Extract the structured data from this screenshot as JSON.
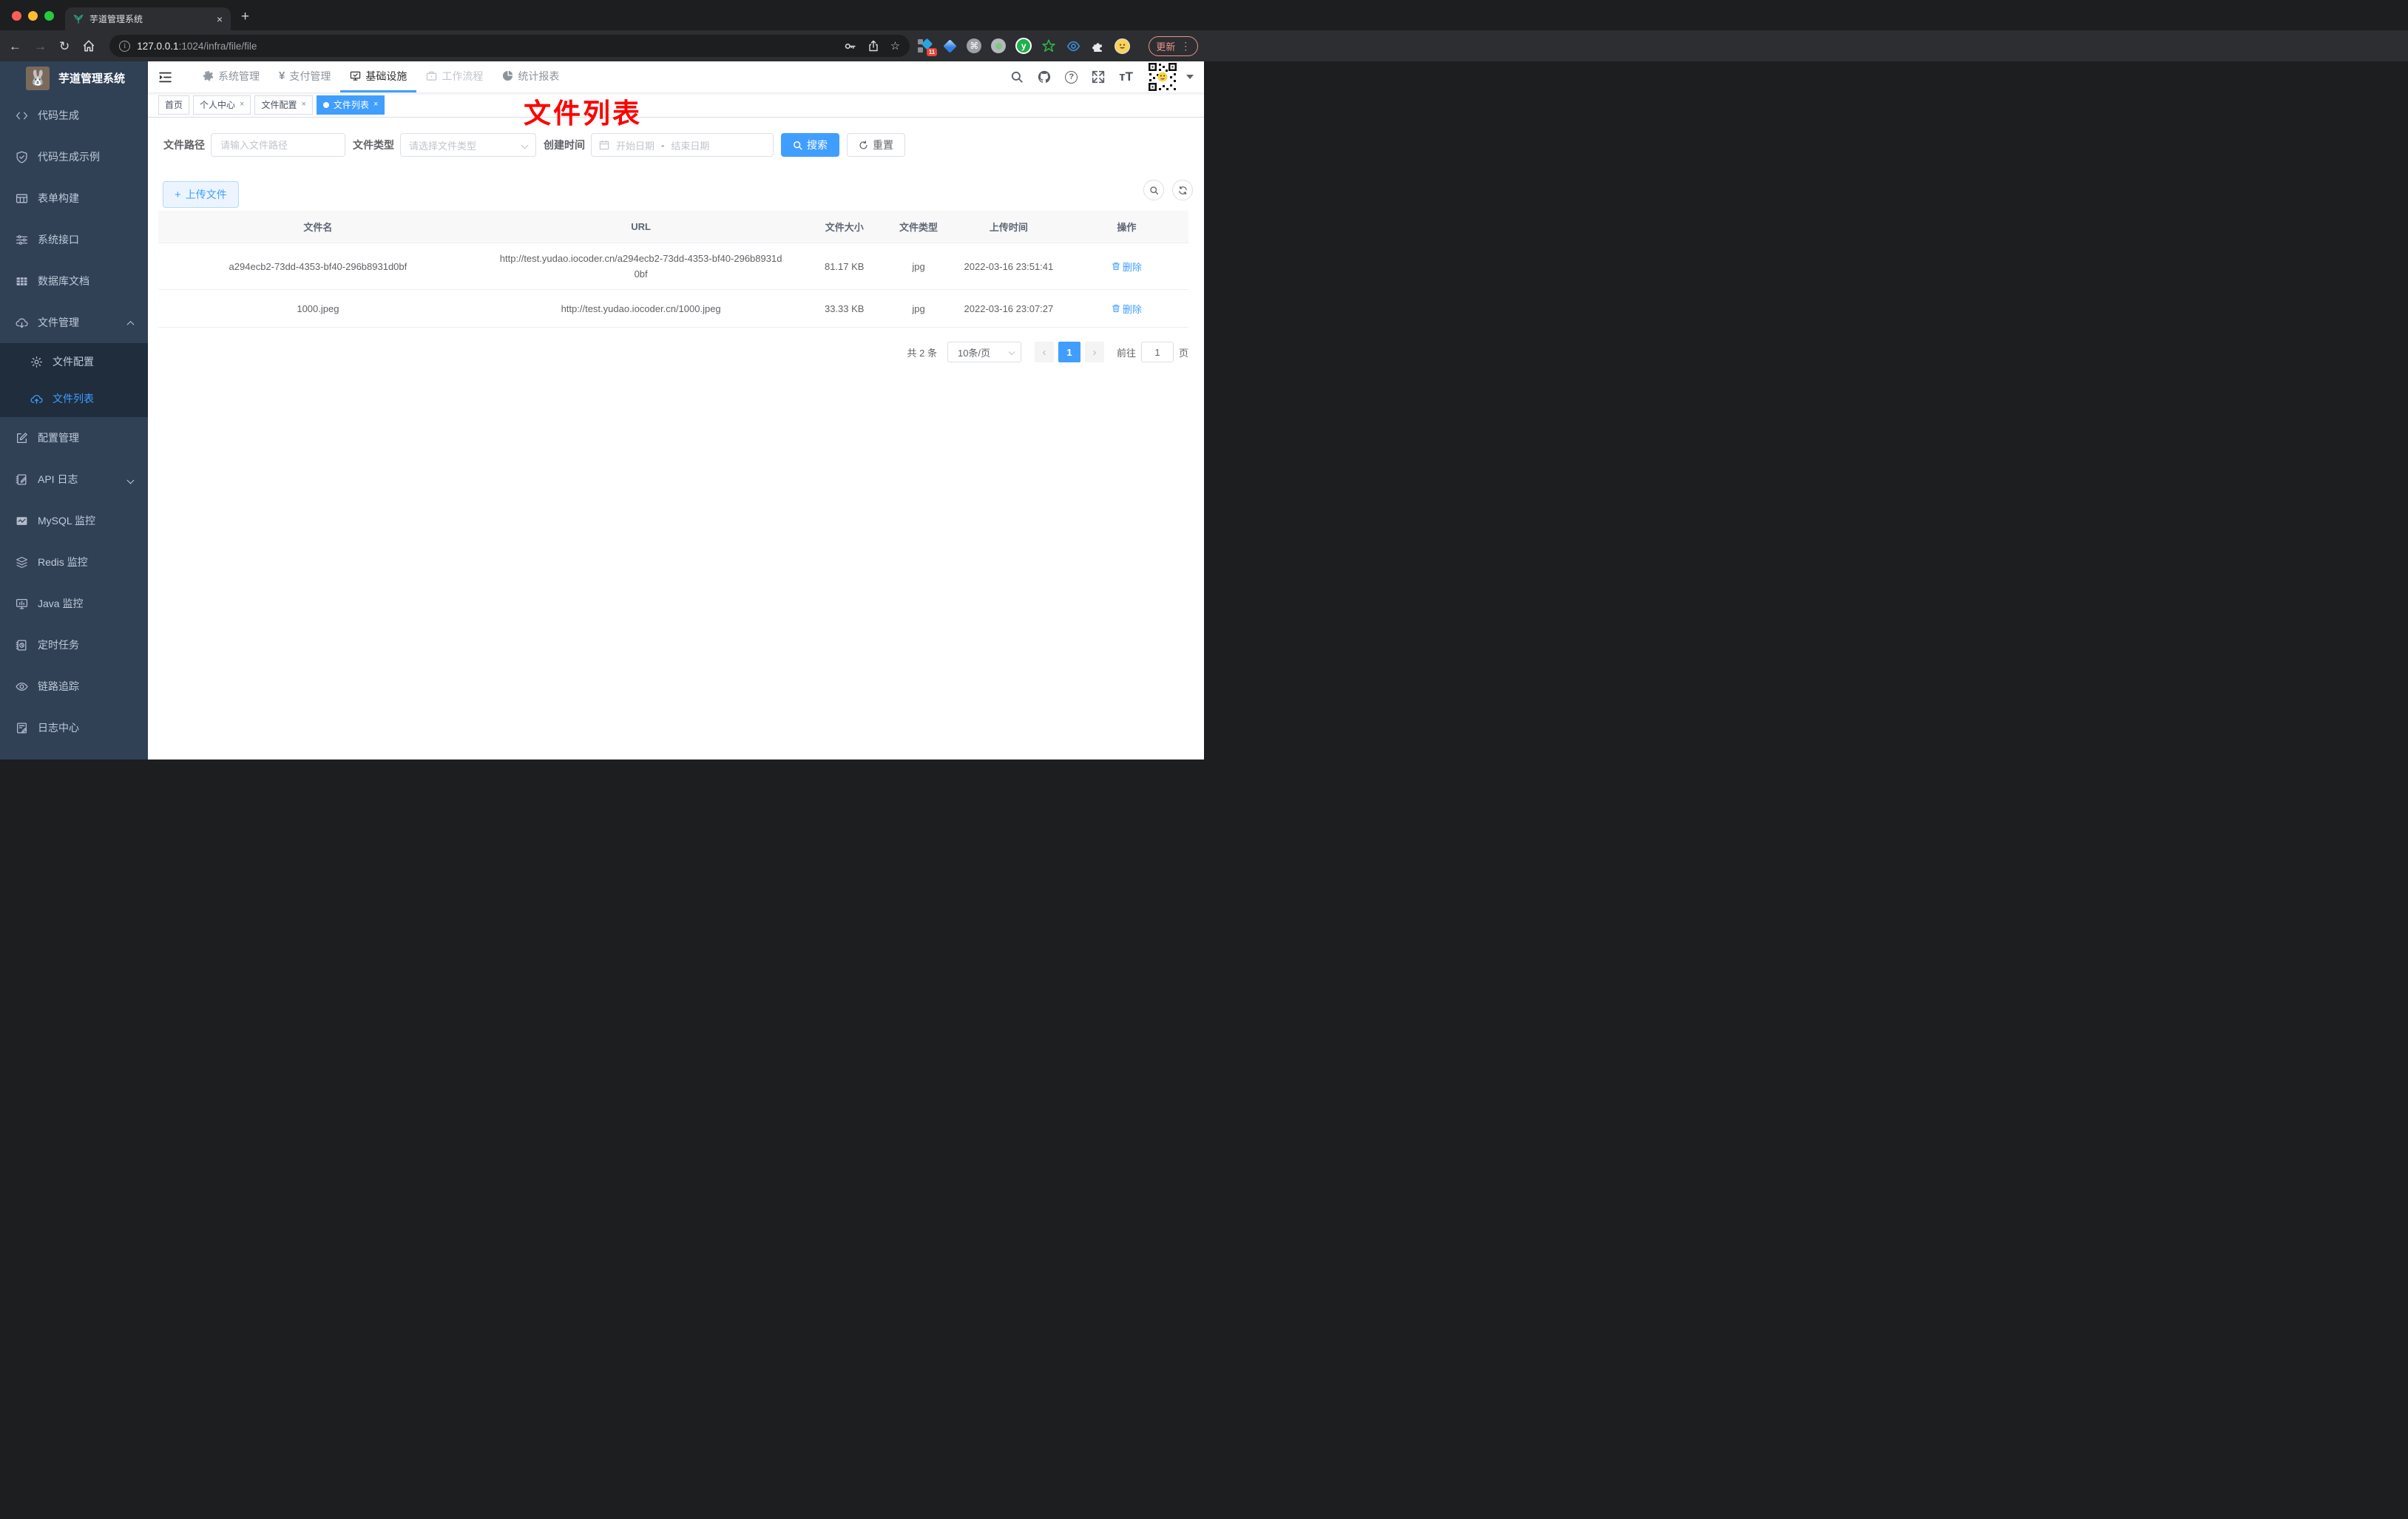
{
  "browser": {
    "tab_title": "芋道管理系统",
    "url_host": "127.0.0.1",
    "url_path": ":1024/infra/file/file",
    "update_label": "更新",
    "extension_badge_count": "11"
  },
  "icons": {
    "close": "×",
    "plus": "+",
    "back": "←",
    "forward": "→",
    "reload": "↻",
    "star": "☆",
    "command": "⌘",
    "dots_v": "⋮",
    "yen": "¥",
    "question": "?",
    "text_size": "тT",
    "info": "i",
    "prev": "‹",
    "next": "›",
    "letter_y": "y",
    "plus_small": "+",
    "rabbit": "🐰"
  },
  "sidebar": {
    "title": "芋道管理系统",
    "menu": [
      {
        "label": "代码生成",
        "icon": "code-icon"
      },
      {
        "label": "代码生成示例",
        "icon": "shield-check-icon"
      },
      {
        "label": "表单构建",
        "icon": "table-icon"
      },
      {
        "label": "系统接口",
        "icon": "sliders-icon"
      },
      {
        "label": "数据库文档",
        "icon": "database-grid-icon"
      },
      {
        "label": "文件管理",
        "icon": "cloud-download-icon",
        "state": "expanded"
      },
      {
        "label": "文件配置",
        "icon": "gear-icon",
        "sub": true
      },
      {
        "label": "文件列表",
        "icon": "cloud-upload-icon",
        "sub": true,
        "active": true
      },
      {
        "label": "配置管理",
        "icon": "edit-square-icon"
      },
      {
        "label": "API 日志",
        "icon": "log-edit-icon",
        "state": "collapsed"
      },
      {
        "label": "MySQL 监控",
        "icon": "chart-box-icon"
      },
      {
        "label": "Redis 监控",
        "icon": "stack-icon"
      },
      {
        "label": "Java 监控",
        "icon": "monitor-icon"
      },
      {
        "label": "定时任务",
        "icon": "schedule-icon"
      },
      {
        "label": "链路追踪",
        "icon": "eye-icon"
      },
      {
        "label": "日志中心",
        "icon": "log-center-icon"
      }
    ]
  },
  "topnav": {
    "items": [
      {
        "label": "系统管理",
        "icon": "gear-icon"
      },
      {
        "label": "支付管理",
        "icon": "yen-icon"
      },
      {
        "label": "基础设施",
        "icon": "monitor-check-icon",
        "active": true
      },
      {
        "label": "工作流程",
        "icon": "briefcase-icon"
      },
      {
        "label": "统计报表",
        "icon": "pie-chart-icon"
      }
    ]
  },
  "tags": {
    "items": [
      {
        "label": "首页",
        "closable": false
      },
      {
        "label": "个人中心",
        "closable": true
      },
      {
        "label": "文件配置",
        "closable": true
      },
      {
        "label": "文件列表",
        "closable": true,
        "active": true
      }
    ]
  },
  "annotation": {
    "text": "文件列表"
  },
  "filters": {
    "path_label": "文件路径",
    "path_placeholder": "请输入文件路径",
    "type_label": "文件类型",
    "type_placeholder": "请选择文件类型",
    "time_label": "创建时间",
    "start_placeholder": "开始日期",
    "separator": "-",
    "end_placeholder": "结束日期",
    "search_label": "搜索",
    "reset_label": "重置"
  },
  "toolbar": {
    "upload_label": "上传文件"
  },
  "table": {
    "headers": [
      "文件名",
      "URL",
      "文件大小",
      "文件类型",
      "上传时间",
      "操作"
    ],
    "rows": [
      {
        "name": "a294ecb2-73dd-4353-bf40-296b8931d0bf",
        "url": "http://test.yudao.iocoder.cn/a294ecb2-73dd-4353-bf40-296b8931d0bf",
        "size": "81.17 KB",
        "type": "jpg",
        "time": "2022-03-16 23:51:41",
        "action": "删除"
      },
      {
        "name": "1000.jpeg",
        "url": "http://test.yudao.iocoder.cn/1000.jpeg",
        "size": "33.33 KB",
        "type": "jpg",
        "time": "2022-03-16 23:07:27",
        "action": "删除"
      }
    ]
  },
  "pagination": {
    "total": "共 2 条",
    "page_size": "10条/页",
    "page": "1",
    "goto_label": "前往",
    "goto_value": "1",
    "unit_label": "页"
  },
  "colors": {
    "accent": "#409eff",
    "sidebar_bg": "#304156",
    "submenu_bg": "#1f2d3d",
    "annotation": "#fe0000"
  }
}
